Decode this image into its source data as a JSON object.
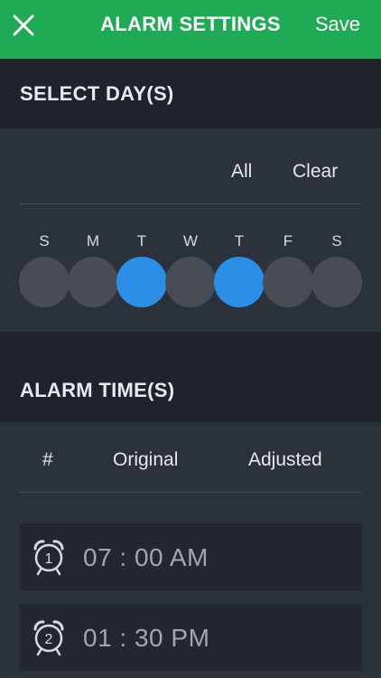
{
  "header": {
    "title": "ALARM SETTINGS",
    "save_label": "Save",
    "close_icon": "close-icon",
    "background_color": "#1faa55"
  },
  "days_section": {
    "heading": "SELECT DAY(S)",
    "all_label": "All",
    "clear_label": "Clear",
    "days": [
      {
        "letter": "S",
        "selected": false
      },
      {
        "letter": "M",
        "selected": false
      },
      {
        "letter": "T",
        "selected": true
      },
      {
        "letter": "W",
        "selected": false
      },
      {
        "letter": "T",
        "selected": true
      },
      {
        "letter": "F",
        "selected": false
      },
      {
        "letter": "S",
        "selected": false
      }
    ],
    "selected_color": "#2b8fe8",
    "unselected_color": "#474c55"
  },
  "times_section": {
    "heading": "ALARM TIME(S)",
    "columns": {
      "number": "#",
      "original": "Original",
      "adjusted": "Adjusted"
    },
    "alarms": [
      {
        "number": "1",
        "time": "07 : 00 AM",
        "icon": "alarm-clock-icon"
      },
      {
        "number": "2",
        "time": "01 : 30 PM",
        "icon": "alarm-clock-icon"
      }
    ]
  }
}
